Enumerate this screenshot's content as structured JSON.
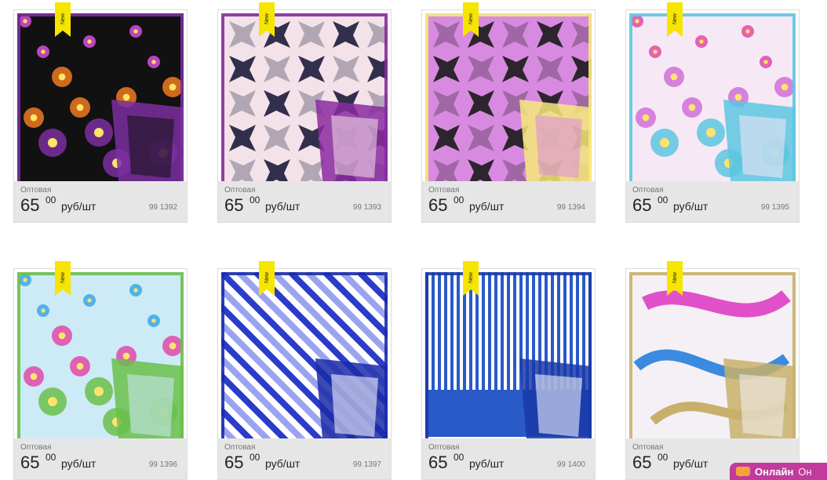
{
  "new_label": "New",
  "products": [
    {
      "label": "Оптовая",
      "price_int": "65",
      "price_dec": "00",
      "unit": "руб/шт",
      "code": "99 1392",
      "colors": [
        "#111111",
        "#d94fd8",
        "#f07a20",
        "#7b2fa0"
      ]
    },
    {
      "label": "Оптовая",
      "price_int": "65",
      "price_dec": "00",
      "unit": "руб/шт",
      "code": "99 1393",
      "colors": [
        "#f3e2e8",
        "#1c1c3a",
        "#c9c7e6",
        "#8a2aa0"
      ]
    },
    {
      "label": "Оптовая",
      "price_int": "65",
      "price_dec": "00",
      "unit": "руб/шт",
      "code": "99 1394",
      "colors": [
        "#d88ae0",
        "#1a1a1a",
        "#e22c9c",
        "#f6e97a"
      ]
    },
    {
      "label": "Оптовая",
      "price_int": "65",
      "price_dec": "00",
      "unit": "руб/шт",
      "code": "99 1395",
      "colors": [
        "#f7e8f6",
        "#e04aa8",
        "#d070d8",
        "#5cc6e0"
      ]
    },
    {
      "label": "Оптовая",
      "price_int": "65",
      "price_dec": "00",
      "unit": "руб/шт",
      "code": "99 1396",
      "colors": [
        "#cdeaf7",
        "#3aa8e6",
        "#e04aa8",
        "#6ac04a"
      ]
    },
    {
      "label": "Оптовая",
      "price_int": "65",
      "price_dec": "00",
      "unit": "руб/шт",
      "code": "99 1397",
      "colors": [
        "#ffffff",
        "#2a3cc8",
        "#9aa4ee",
        "#1a2aa8"
      ]
    },
    {
      "label": "Оптовая",
      "price_int": "65",
      "price_dec": "00",
      "unit": "руб/шт",
      "code": "99 1400",
      "colors": [
        "#ffffff",
        "#e2302a",
        "#2a5ac8",
        "#1a3aa8"
      ]
    },
    {
      "label": "Оптовая",
      "price_int": "65",
      "price_dec": "00",
      "unit": "руб/шт",
      "code": "",
      "colors": [
        "#f4f0f6",
        "#e050c8",
        "#3a8ae0",
        "#c8b06a"
      ]
    }
  ],
  "chat": {
    "label": "Онлайн",
    "second": "Он"
  }
}
